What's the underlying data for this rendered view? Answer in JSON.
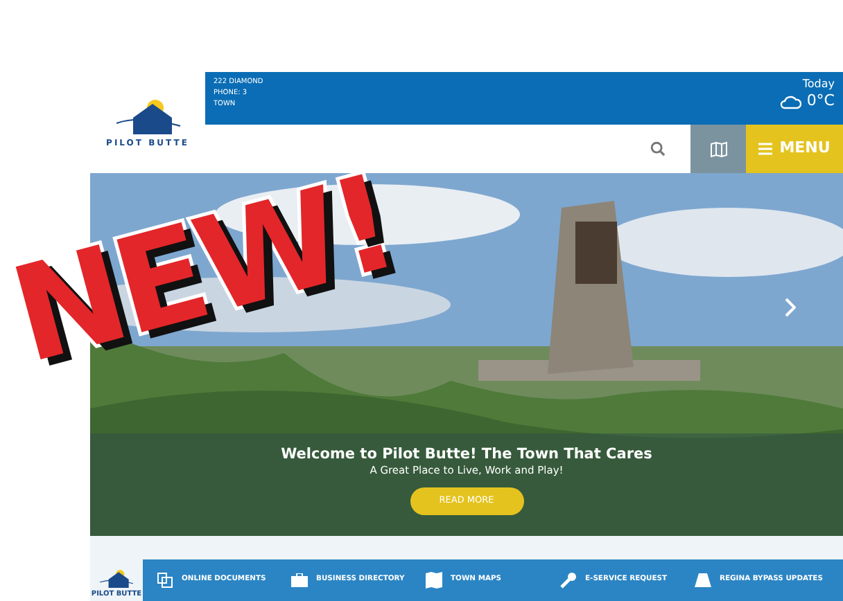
{
  "sticker": {
    "text": "NEW!"
  },
  "header": {
    "logo_text": "PILOT BUTTE",
    "address_lines": [
      "222 DIAMOND",
      "PHONE: 3",
      "TOWN"
    ],
    "weather": {
      "label": "Today",
      "temperature": "0°C"
    }
  },
  "menu_button": "MENU",
  "hero": {
    "kind": "picture",
    "title": "Welcome to Pilot Butte! The Town That Cares",
    "subtitle": "A Great Place to Live, Work and Play!",
    "button": "READ MORE"
  },
  "footer_logo_text": "PILOT BUTTE",
  "quick_links": [
    {
      "kind": "documents",
      "label": "ONLINE DOCUMENTS"
    },
    {
      "kind": "briefcase",
      "label": "BUSINESS DIRECTORY"
    },
    {
      "kind": "map",
      "label": "TOWN MAPS"
    },
    {
      "kind": "wrench",
      "label": "E-SERVICE REQUEST"
    },
    {
      "kind": "road",
      "label": "REGINA BYPASS UPDATES"
    }
  ]
}
